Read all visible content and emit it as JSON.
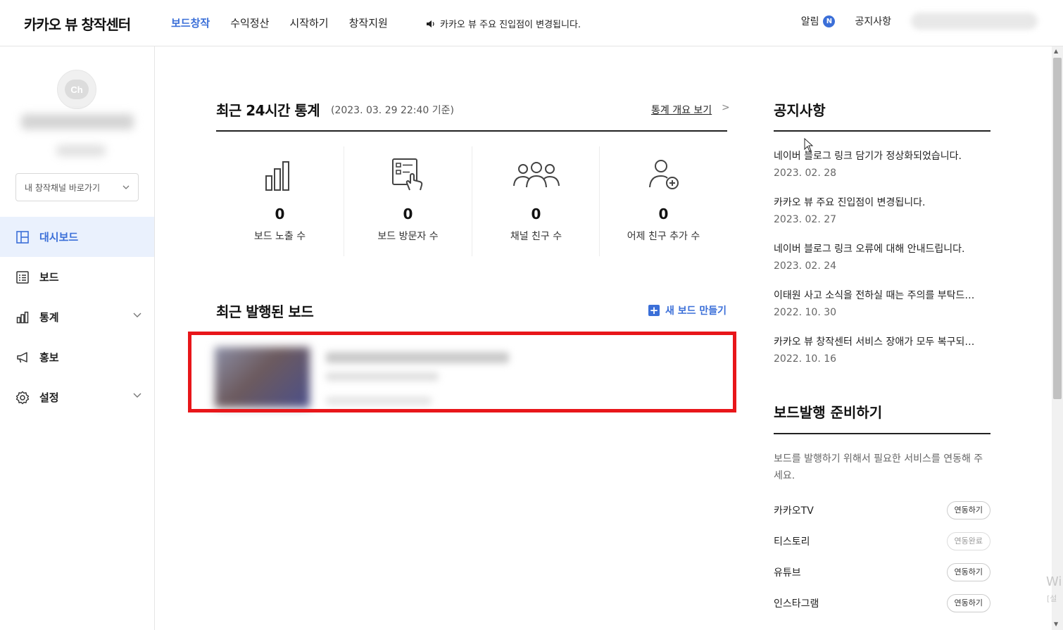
{
  "header": {
    "logo": "카카오 뷰 창작센터",
    "nav": [
      {
        "label": "보드창작",
        "active": true
      },
      {
        "label": "수익정산",
        "active": false
      },
      {
        "label": "시작하기",
        "active": false
      },
      {
        "label": "창작지원",
        "active": false
      }
    ],
    "ticker": "카카오 뷰 주요 진입점이 변경됩니다.",
    "alarm_label": "알림",
    "alarm_badge": "N",
    "notice_label": "공지사항"
  },
  "sidebar": {
    "avatar_text": "Ch",
    "channel_select": "내 창작채널 바로가기",
    "items": [
      {
        "label": "대시보드",
        "icon": "dashboard-icon",
        "active": true,
        "expandable": false
      },
      {
        "label": "보드",
        "icon": "list-icon",
        "active": false,
        "expandable": false
      },
      {
        "label": "통계",
        "icon": "bar-chart-icon",
        "active": false,
        "expandable": true
      },
      {
        "label": "홍보",
        "icon": "megaphone-icon",
        "active": false,
        "expandable": false
      },
      {
        "label": "설정",
        "icon": "gear-icon",
        "active": false,
        "expandable": true
      }
    ]
  },
  "stats": {
    "title": "최근 24시간 통계",
    "date": "(2023. 03. 29 22:40 기준)",
    "overview_link": "통계 개요 보기",
    "overview_arrow": ">",
    "cards": [
      {
        "icon": "bar-chart-icon",
        "value": "0",
        "label": "보드 노출 수"
      },
      {
        "icon": "touch-board-icon",
        "value": "0",
        "label": "보드 방문자 수"
      },
      {
        "icon": "group-icon",
        "value": "0",
        "label": "채널 친구 수"
      },
      {
        "icon": "add-friend-icon",
        "value": "0",
        "label": "어제 친구 추가 수"
      }
    ]
  },
  "recent": {
    "title": "최근 발행된 보드",
    "new_board": "새 보드 만들기",
    "plus": "+"
  },
  "notices": {
    "title": "공지사항",
    "items": [
      {
        "title": "네이버 블로그 링크 담기가 정상화되었습니다.",
        "date": "2023. 02. 28"
      },
      {
        "title": "카카오 뷰 주요 진입점이 변경됩니다.",
        "date": "2023. 02. 27"
      },
      {
        "title": "네이버 블로그 링크 오류에 대해 안내드립니다.",
        "date": "2023. 02. 24"
      },
      {
        "title": "이태원 사고 소식을 전하실 때는 주의를 부탁드…",
        "date": "2022. 10. 30"
      },
      {
        "title": "카카오 뷰 창작센터 서비스 장애가 모두 복구되…",
        "date": "2022. 10. 16"
      }
    ]
  },
  "prep": {
    "title": "보드발행 준비하기",
    "desc": "보드를 발행하기 위해서 필요한 서비스를 연동해 주세요.",
    "links": [
      {
        "name": "카카오TV",
        "button": "연동하기",
        "done": false
      },
      {
        "name": "티스토리",
        "button": "연동완료",
        "done": true
      },
      {
        "name": "유튜브",
        "button": "연동하기",
        "done": false
      },
      {
        "name": "인스타그램",
        "button": "연동하기",
        "done": false
      }
    ]
  },
  "watermark": {
    "line1": "Wi",
    "line2": "[설"
  },
  "colors": {
    "accent": "#3b6fd8",
    "highlight": "#e8161a",
    "active_bg": "#eaf1fd"
  }
}
